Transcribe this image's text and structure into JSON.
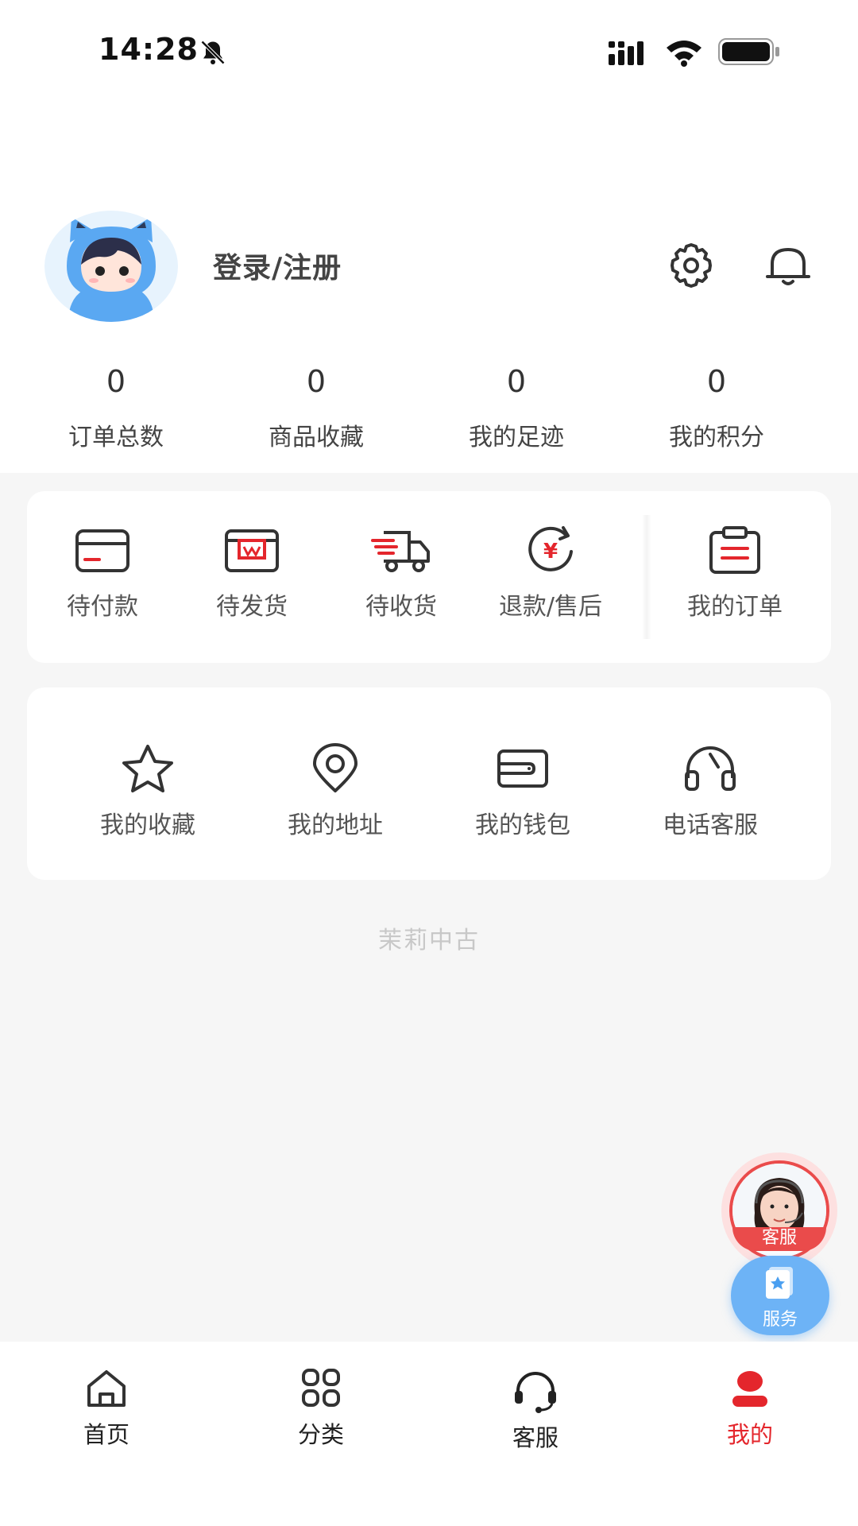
{
  "status_bar": {
    "time": "14:28"
  },
  "profile": {
    "login_label": "登录/注册"
  },
  "stats": [
    {
      "value": "0",
      "label": "订单总数"
    },
    {
      "value": "0",
      "label": "商品收藏"
    },
    {
      "value": "0",
      "label": "我的足迹"
    },
    {
      "value": "0",
      "label": "我的积分"
    }
  ],
  "orders": [
    {
      "label": "待付款",
      "icon": "card-icon"
    },
    {
      "label": "待发货",
      "icon": "box-icon"
    },
    {
      "label": "待收货",
      "icon": "truck-icon"
    },
    {
      "label": "退款/售后",
      "icon": "refund-icon"
    },
    {
      "label": "我的订单",
      "icon": "clipboard-icon"
    }
  ],
  "services": [
    {
      "label": "我的收藏",
      "icon": "star-icon"
    },
    {
      "label": "我的地址",
      "icon": "location-icon"
    },
    {
      "label": "我的钱包",
      "icon": "wallet-icon"
    },
    {
      "label": "电话客服",
      "icon": "headset-icon"
    }
  ],
  "brand": "茉莉中古",
  "floating": {
    "kefu_label": "客服",
    "service_label": "服务"
  },
  "tabs": [
    {
      "label": "首页",
      "icon": "home-icon"
    },
    {
      "label": "分类",
      "icon": "grid-icon"
    },
    {
      "label": "客服",
      "icon": "headset-icon"
    },
    {
      "label": "我的",
      "icon": "user-icon",
      "active": true
    }
  ],
  "colors": {
    "accent": "#e4262c",
    "service_blue": "#6db3f6"
  }
}
